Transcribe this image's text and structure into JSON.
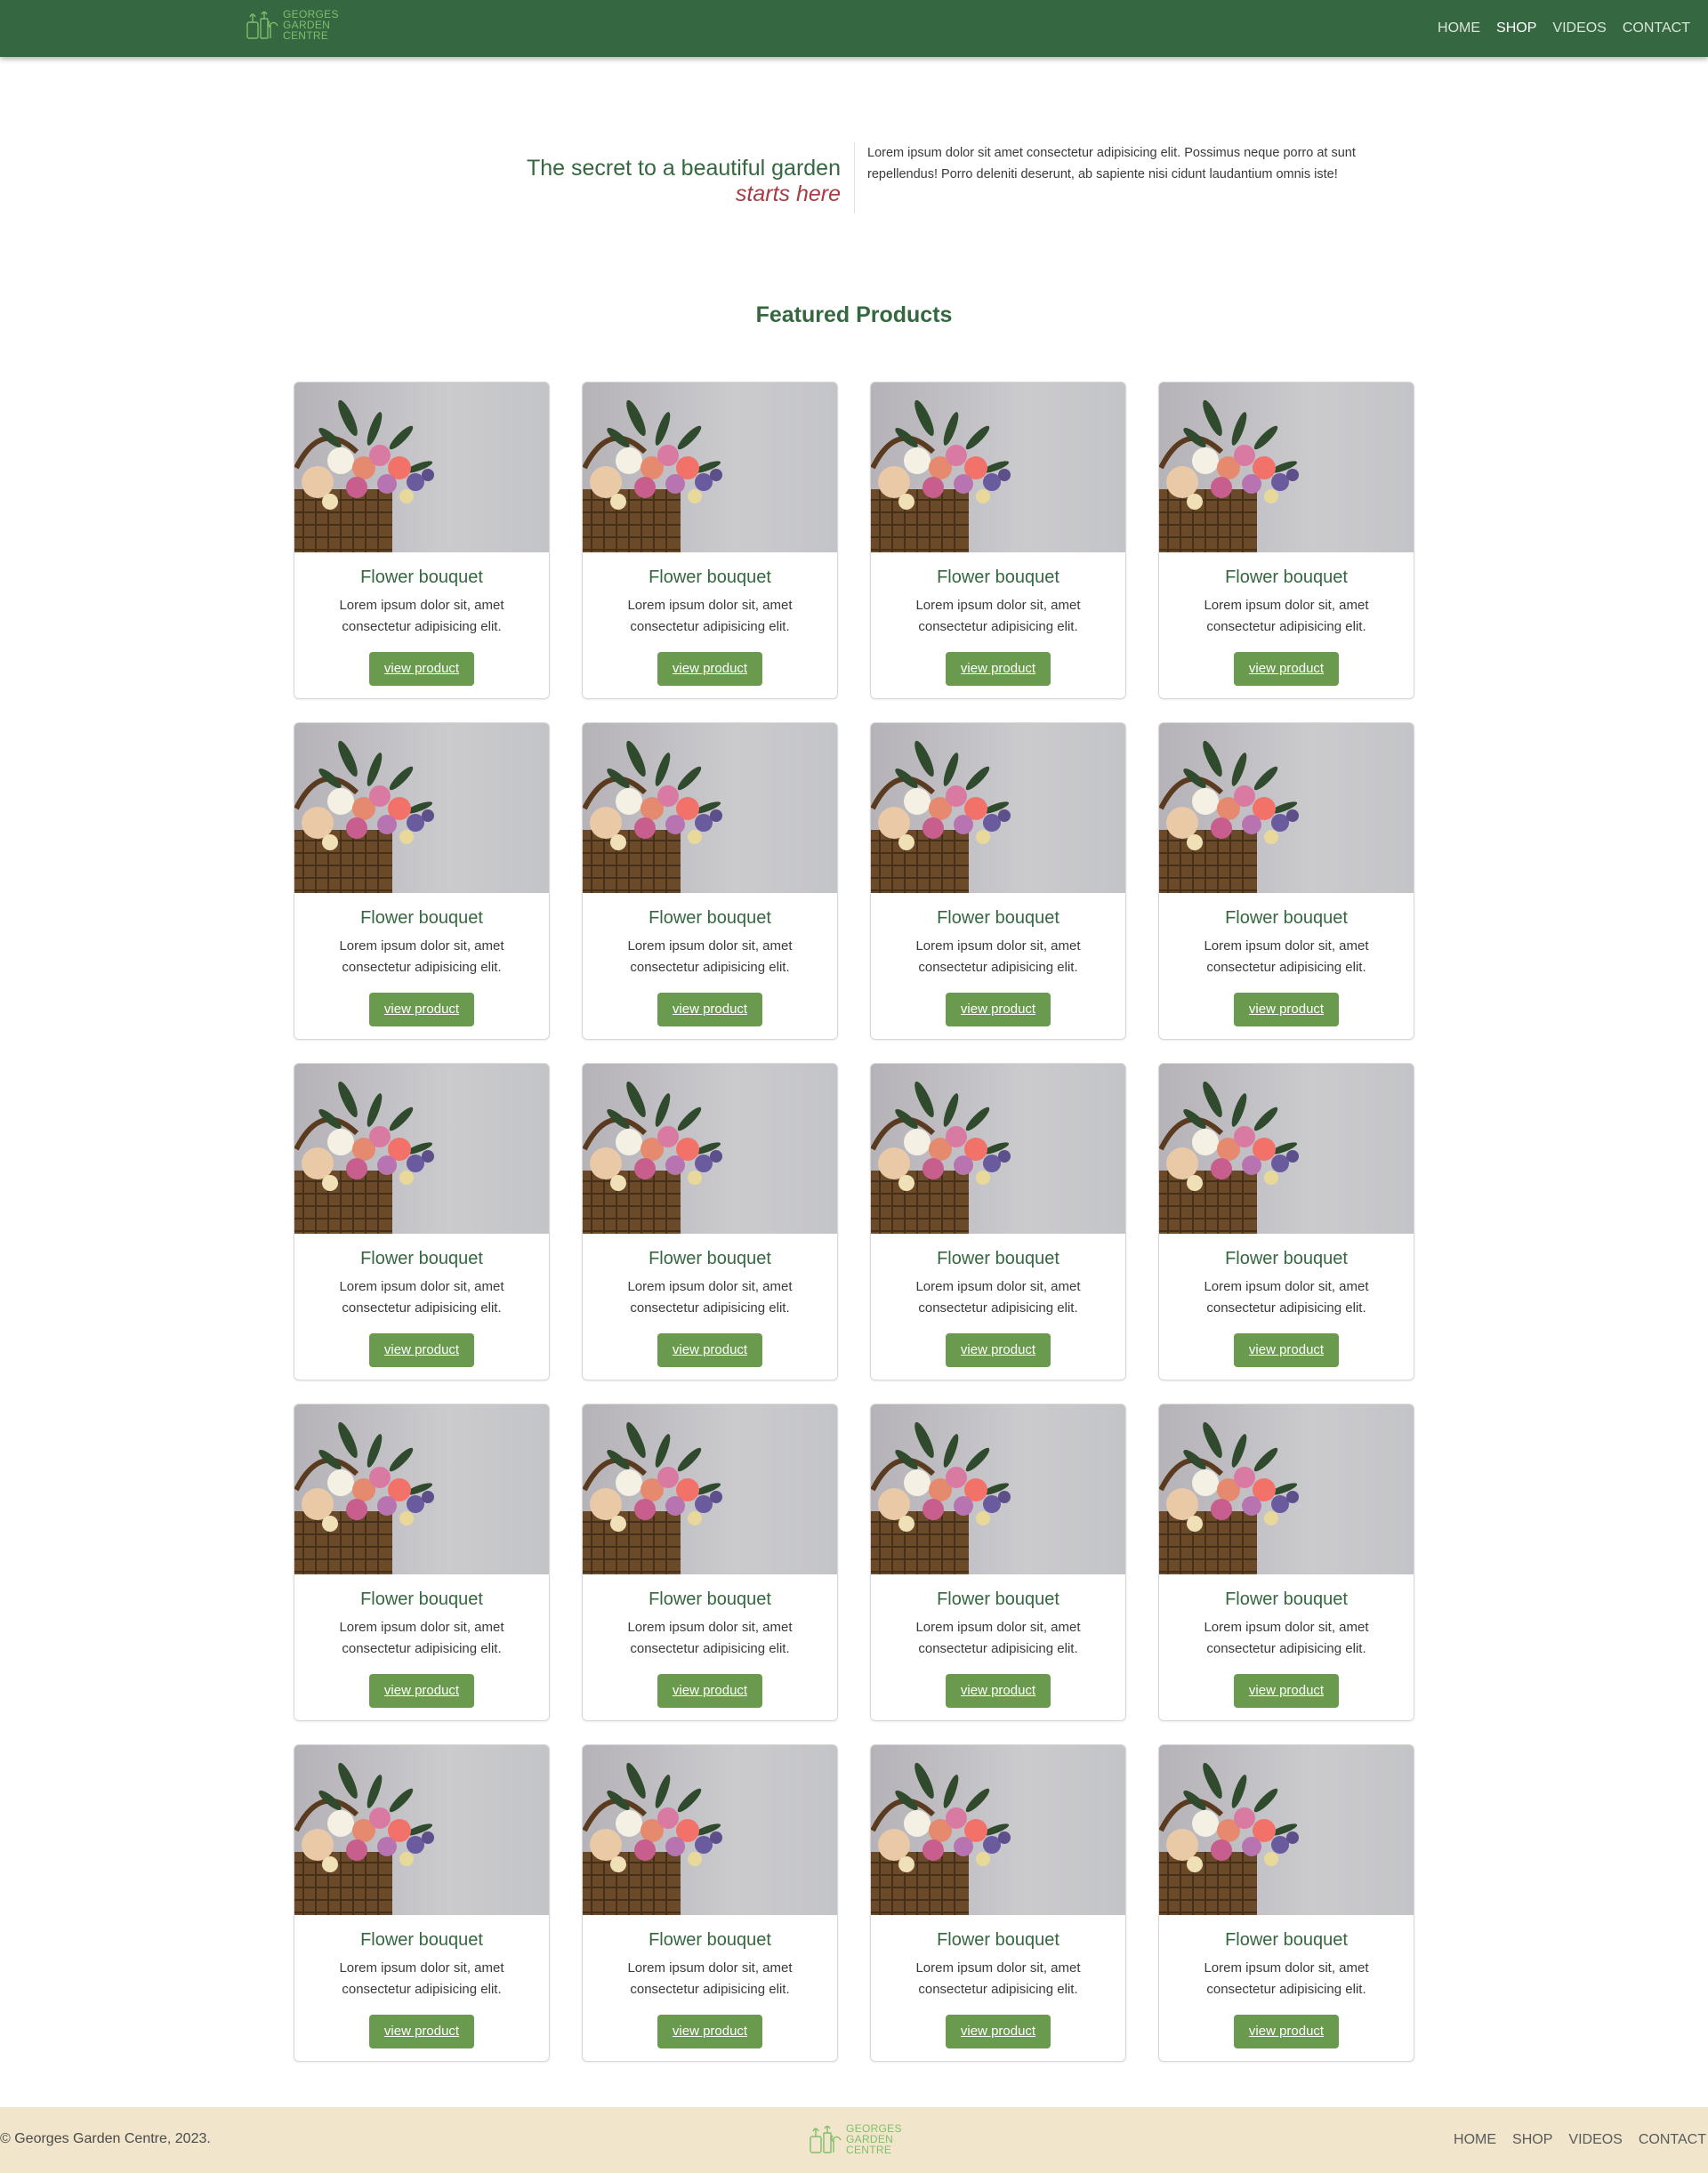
{
  "brand": {
    "logo_lines": [
      "GEORGES",
      "GARDEN",
      "CENTRE"
    ],
    "primary_color": "#356740",
    "accent_color": "#a63d44",
    "button_color": "#6a9a4d",
    "footer_bg": "#f1e6cb"
  },
  "nav": {
    "items": [
      {
        "label": "HOME",
        "active": false
      },
      {
        "label": "SHOP",
        "active": true
      },
      {
        "label": "VIDEOS",
        "active": false
      },
      {
        "label": "CONTACT",
        "active": false
      }
    ]
  },
  "hero": {
    "title": "The secret to a beautiful garden",
    "subtitle": "starts here",
    "text": "Lorem ipsum dolor sit amet consectetur adipisicing elit. Possimus neque porro at sunt repellendus! Porro deleniti deserunt, ab sapiente nisi cidunt laudantium omnis iste!"
  },
  "featured": {
    "title": "Featured Products",
    "products": [
      {
        "title": "Flower bouquet",
        "text": "Lorem ipsum dolor sit, amet consectetur adipisicing elit.",
        "button": "view product"
      },
      {
        "title": "Flower bouquet",
        "text": "Lorem ipsum dolor sit, amet consectetur adipisicing elit.",
        "button": "view product"
      },
      {
        "title": "Flower bouquet",
        "text": "Lorem ipsum dolor sit, amet consectetur adipisicing elit.",
        "button": "view product"
      },
      {
        "title": "Flower bouquet",
        "text": "Lorem ipsum dolor sit, amet consectetur adipisicing elit.",
        "button": "view product"
      },
      {
        "title": "Flower bouquet",
        "text": "Lorem ipsum dolor sit, amet consectetur adipisicing elit.",
        "button": "view product"
      },
      {
        "title": "Flower bouquet",
        "text": "Lorem ipsum dolor sit, amet consectetur adipisicing elit.",
        "button": "view product"
      },
      {
        "title": "Flower bouquet",
        "text": "Lorem ipsum dolor sit, amet consectetur adipisicing elit.",
        "button": "view product"
      },
      {
        "title": "Flower bouquet",
        "text": "Lorem ipsum dolor sit, amet consectetur adipisicing elit.",
        "button": "view product"
      },
      {
        "title": "Flower bouquet",
        "text": "Lorem ipsum dolor sit, amet consectetur adipisicing elit.",
        "button": "view product"
      },
      {
        "title": "Flower bouquet",
        "text": "Lorem ipsum dolor sit, amet consectetur adipisicing elit.",
        "button": "view product"
      },
      {
        "title": "Flower bouquet",
        "text": "Lorem ipsum dolor sit, amet consectetur adipisicing elit.",
        "button": "view product"
      },
      {
        "title": "Flower bouquet",
        "text": "Lorem ipsum dolor sit, amet consectetur adipisicing elit.",
        "button": "view product"
      },
      {
        "title": "Flower bouquet",
        "text": "Lorem ipsum dolor sit, amet consectetur adipisicing elit.",
        "button": "view product"
      },
      {
        "title": "Flower bouquet",
        "text": "Lorem ipsum dolor sit, amet consectetur adipisicing elit.",
        "button": "view product"
      },
      {
        "title": "Flower bouquet",
        "text": "Lorem ipsum dolor sit, amet consectetur adipisicing elit.",
        "button": "view product"
      },
      {
        "title": "Flower bouquet",
        "text": "Lorem ipsum dolor sit, amet consectetur adipisicing elit.",
        "button": "view product"
      },
      {
        "title": "Flower bouquet",
        "text": "Lorem ipsum dolor sit, amet consectetur adipisicing elit.",
        "button": "view product"
      },
      {
        "title": "Flower bouquet",
        "text": "Lorem ipsum dolor sit, amet consectetur adipisicing elit.",
        "button": "view product"
      },
      {
        "title": "Flower bouquet",
        "text": "Lorem ipsum dolor sit, amet consectetur adipisicing elit.",
        "button": "view product"
      },
      {
        "title": "Flower bouquet",
        "text": "Lorem ipsum dolor sit, amet consectetur adipisicing elit.",
        "button": "view product"
      }
    ]
  },
  "footer": {
    "copyright": "© Georges Garden Centre, 2023.",
    "items": [
      {
        "label": "HOME"
      },
      {
        "label": "SHOP"
      },
      {
        "label": "VIDEOS"
      },
      {
        "label": "CONTACT"
      }
    ]
  }
}
